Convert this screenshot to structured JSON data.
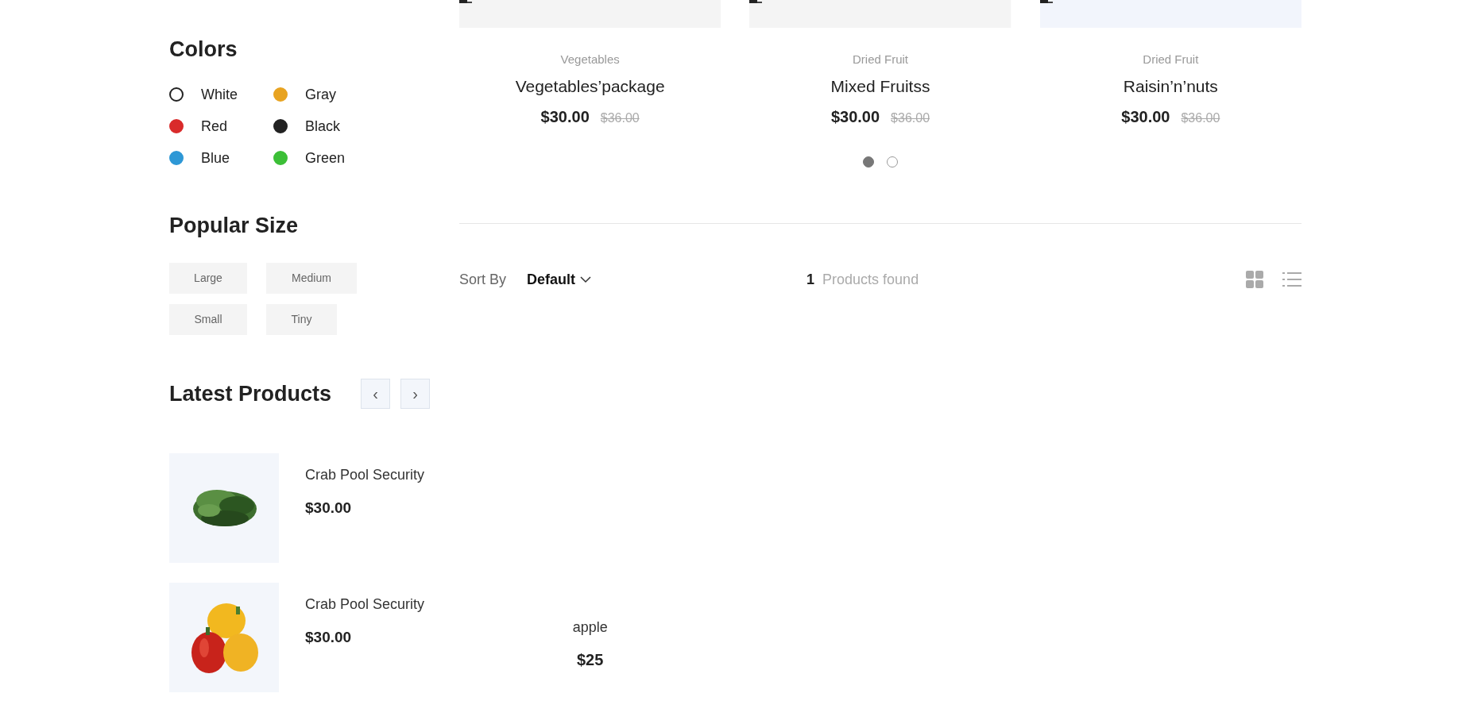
{
  "sidebar": {
    "colors": {
      "title": "Colors",
      "items": [
        {
          "label": "White",
          "color": "#ffffff"
        },
        {
          "label": "Gray",
          "color": "#e8a321"
        },
        {
          "label": "Red",
          "color": "#d92b2b"
        },
        {
          "label": "Black",
          "color": "#222222"
        },
        {
          "label": "Blue",
          "color": "#2e98d6"
        },
        {
          "label": "Green",
          "color": "#3cbf37"
        }
      ]
    },
    "sizes": {
      "title": "Popular Size",
      "items": [
        "Large",
        "Medium",
        "Small",
        "Tiny"
      ]
    },
    "latest": {
      "title": "Latest Products",
      "prev": "‹",
      "next": "›",
      "items": [
        {
          "name": "Crab Pool Security",
          "price": "$30.00",
          "kind": "greens"
        },
        {
          "name": "Crab Pool Security",
          "price": "$30.00",
          "kind": "peppers"
        }
      ]
    }
  },
  "carousel": {
    "products": [
      {
        "category": "Vegetables",
        "name": "Vegetables’package",
        "price": "$30.00",
        "old_price": "$36.00"
      },
      {
        "category": "Dried Fruit",
        "name": "Mixed Fruitss",
        "price": "$30.00",
        "old_price": "$36.00"
      },
      {
        "category": "Dried Fruit",
        "name": "Raisin’n’nuts",
        "price": "$30.00",
        "old_price": "$36.00"
      }
    ],
    "dots": [
      {
        "selected": true
      },
      {
        "selected": false
      }
    ]
  },
  "toolbar": {
    "sort_label": "Sort By",
    "sort_value": "Default",
    "count": "1",
    "count_label": "Products found"
  },
  "results": [
    {
      "name": "apple",
      "price": "$25"
    }
  ]
}
